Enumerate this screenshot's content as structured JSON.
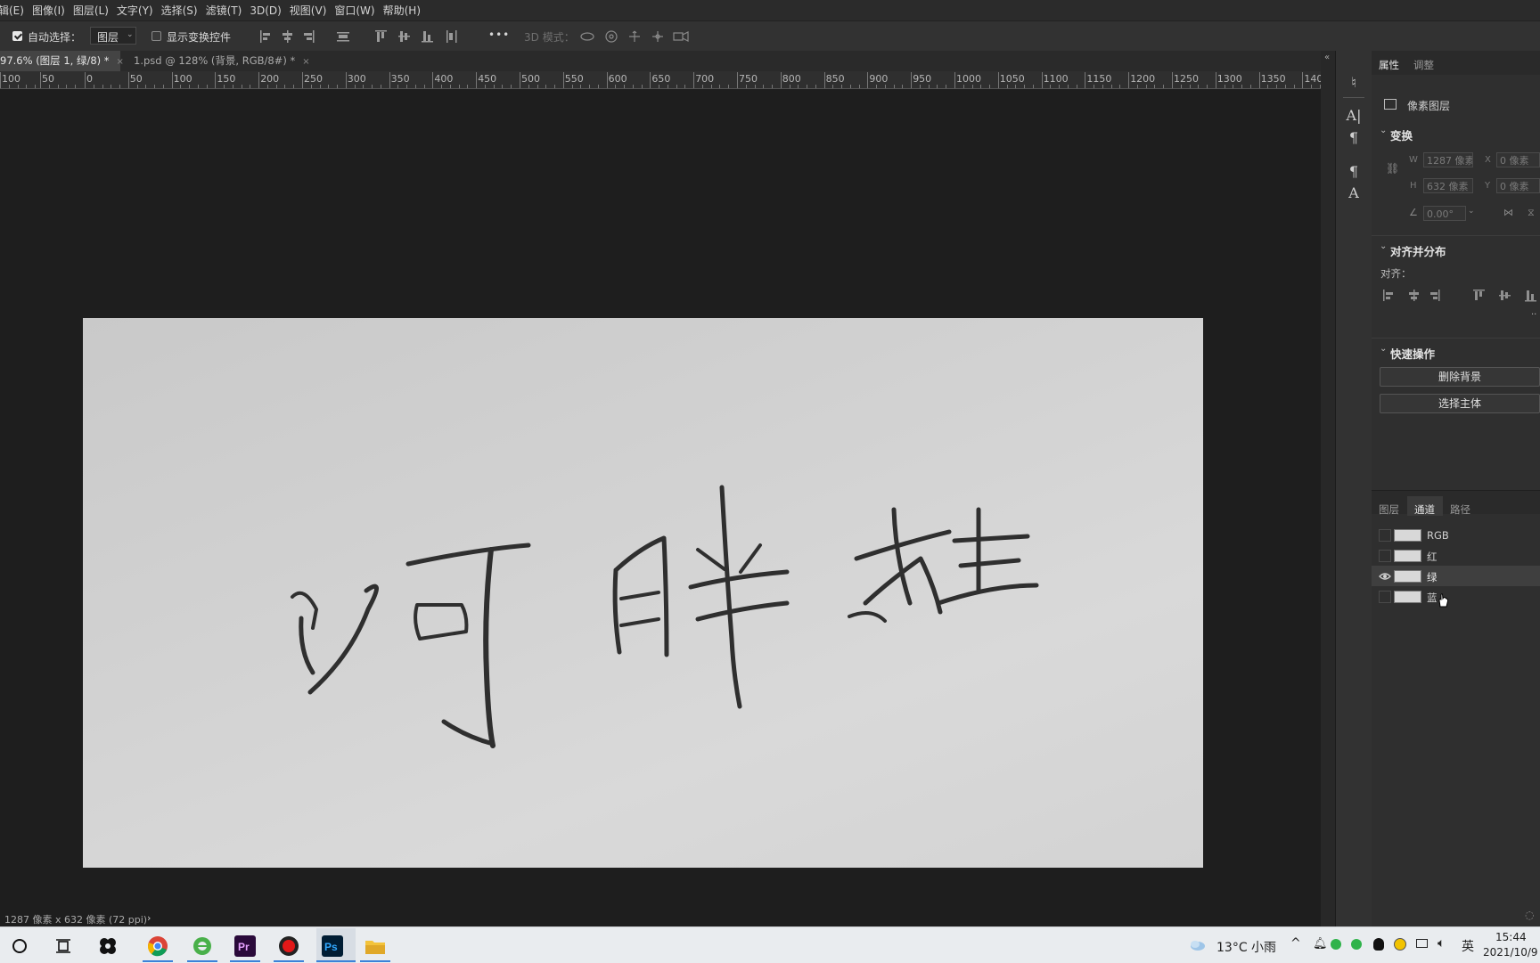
{
  "menu": [
    "辑(E)",
    "图像(I)",
    "图层(L)",
    "文字(Y)",
    "选择(S)",
    "滤镜(T)",
    "3D(D)",
    "视图(V)",
    "窗口(W)",
    "帮助(H)"
  ],
  "options": {
    "auto_select_label": "自动选择：",
    "auto_select_value": "图层",
    "show_transform_label": "显示变换控件",
    "more": "•••",
    "mode_3d": "3D 模式："
  },
  "tabs": [
    {
      "label": "97.6% (图层 1, 绿/8) *",
      "close": "×"
    },
    {
      "label": "1.psd @ 128% (背景, RGB/8#) *",
      "close": "×"
    }
  ],
  "ruler_labels": [
    "100",
    "50",
    "0",
    "50",
    "100",
    "150",
    "200",
    "250",
    "300",
    "350",
    "400",
    "450",
    "500",
    "550",
    "600",
    "650",
    "700",
    "750",
    "800",
    "850",
    "900",
    "950",
    "1000",
    "1050",
    "1100",
    "1150",
    "1200",
    "1250",
    "1300",
    "1350",
    "140"
  ],
  "status_text": "1287 像素 x 632 像素 (72 ppi)",
  "status_arrow": "›",
  "panel": {
    "tabs": [
      "属性",
      "调整"
    ],
    "layer_type": "像素图层",
    "transform_title": "变换",
    "w_label": "W",
    "w_value": "1287 像素",
    "h_label": "H",
    "h_value": "632 像素",
    "x_label": "X",
    "x_value": "0 像素",
    "y_label": "Y",
    "y_value": "0 像素",
    "angle_value": "0.00°",
    "align_title": "对齐并分布",
    "align_label": "对齐：",
    "quick_title": "快速操作",
    "remove_bg": "删除背景",
    "select_subject": "选择主体",
    "lower_tabs": [
      "图层",
      "通道",
      "路径"
    ],
    "channels": [
      {
        "name": "RGB",
        "visible": false
      },
      {
        "name": "红",
        "visible": false
      },
      {
        "name": "绿",
        "visible": true
      },
      {
        "name": "蓝",
        "visible": false
      }
    ]
  },
  "taskbar": {
    "weather": "13°C  小雨",
    "ime": "英",
    "time": "15:44",
    "date": "2021/10/9"
  },
  "colors": {
    "accent": "#3b82d9",
    "panel_bg": "#2f2f2f",
    "canvas_bg": "#1e1e1e",
    "doc_bg": "#d2d2d2"
  }
}
